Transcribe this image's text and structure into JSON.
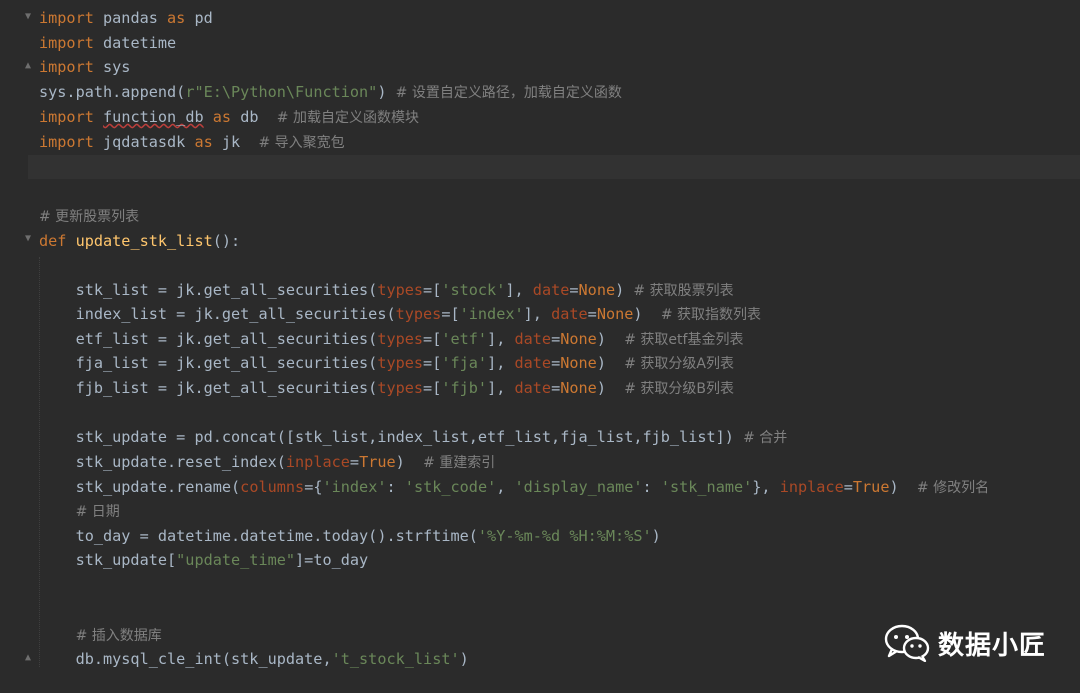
{
  "colors": {
    "background": "#2b2b2b",
    "keyword": "#cc7832",
    "string": "#6a8759",
    "comment": "#808080",
    "function_name": "#ffc66d",
    "parameter": "#aa4926",
    "default": "#a9b7c6"
  },
  "code": {
    "l1": {
      "t1": "import",
      "t2": " pandas ",
      "t3": "as",
      "t4": " pd"
    },
    "l2": {
      "t1": "import",
      "t2": " datetime"
    },
    "l3": {
      "t1": "import",
      "t2": " sys"
    },
    "l4": {
      "t1": "sys.path.append(",
      "t2": "r\"E:\\Python\\Function\"",
      "t3": ") ",
      "t4": "# 设置自定义路径，加载自定义函数"
    },
    "l5": {
      "t1": "import",
      "t2": " ",
      "t3": "function_db",
      "t4": " ",
      "t5": "as",
      "t6": " db  ",
      "t7": "# 加载自定义函数模块"
    },
    "l6": {
      "t1": "import",
      "t2": " jqdatasdk ",
      "t3": "as",
      "t4": " jk  ",
      "t5": "# 导入聚宽包"
    },
    "l9": {
      "t1": "# 更新股票列表"
    },
    "l10": {
      "t1": "def",
      "t2": " ",
      "t3": "update_stk_list",
      "t4": "():"
    },
    "l12": {
      "t1": "    stk_list = jk.get_all_securities(",
      "t2": "types",
      "t3": "=[",
      "t4": "'stock'",
      "t5": "], ",
      "t6": "date",
      "t7": "=",
      "t8": "None",
      "t9": ") ",
      "t10": "# 获取股票列表"
    },
    "l13": {
      "t1": "    index_list = jk.get_all_securities(",
      "t2": "types",
      "t3": "=[",
      "t4": "'index'",
      "t5": "], ",
      "t6": "date",
      "t7": "=",
      "t8": "None",
      "t9": ")  ",
      "t10": "# 获取指数列表"
    },
    "l14": {
      "t1": "    etf_list = jk.get_all_securities(",
      "t2": "types",
      "t3": "=[",
      "t4": "'etf'",
      "t5": "], ",
      "t6": "date",
      "t7": "=",
      "t8": "None",
      "t9": ")  ",
      "t10": "# 获取etf基金列表"
    },
    "l15": {
      "t1": "    fja_list = jk.get_all_securities(",
      "t2": "types",
      "t3": "=[",
      "t4": "'fja'",
      "t5": "], ",
      "t6": "date",
      "t7": "=",
      "t8": "None",
      "t9": ")  ",
      "t10": "# 获取分级A列表"
    },
    "l16": {
      "t1": "    fjb_list = jk.get_all_securities(",
      "t2": "types",
      "t3": "=[",
      "t4": "'fjb'",
      "t5": "], ",
      "t6": "date",
      "t7": "=",
      "t8": "None",
      "t9": ")  ",
      "t10": "# 获取分级B列表"
    },
    "l18": {
      "t1": "    stk_update = pd.concat([stk_list,index_list,etf_list,fja_list,fjb_list]) ",
      "t2": "# 合并"
    },
    "l19": {
      "t1": "    stk_update.reset_index(",
      "t2": "inplace",
      "t3": "=",
      "t4": "True",
      "t5": ")  ",
      "t6": "# 重建索引"
    },
    "l20": {
      "t1": "    stk_update.rename(",
      "t2": "columns",
      "t3": "={",
      "t4": "'index'",
      "t5": ": ",
      "t6": "'stk_code'",
      "t7": ", ",
      "t8": "'display_name'",
      "t9": ": ",
      "t10": "'stk_name'",
      "t11": "}, ",
      "t12": "inplace",
      "t13": "=",
      "t14": "True",
      "t15": ")  ",
      "t16": "# 修改列名"
    },
    "l21": {
      "t1": "    ",
      "t2": "# 日期"
    },
    "l22": {
      "t1": "    to_day = datetime.datetime.today().strftime(",
      "t2": "'%Y-%m-%d %H:%M:%S'",
      "t3": ")"
    },
    "l23": {
      "t1": "    stk_update[",
      "t2": "\"update_time\"",
      "t3": "]=to_day"
    },
    "l26": {
      "t1": "    ",
      "t2": "# 插入数据库"
    },
    "l27": {
      "t1": "    db.mysql_cle_int(stk_update,",
      "t2": "'t_stock_list'",
      "t3": ")"
    }
  },
  "watermark": {
    "icon": "wechat-icon",
    "text": "数据小匠"
  }
}
